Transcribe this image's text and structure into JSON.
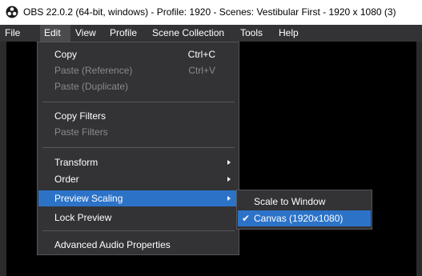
{
  "window": {
    "title": "OBS 22.0.2 (64-bit, windows) - Profile: 1920 - Scenes: Vestibular First - 1920 x 1080 (3)"
  },
  "menubar": {
    "items": [
      {
        "label": "File"
      },
      {
        "label": "Edit"
      },
      {
        "label": "View"
      },
      {
        "label": "Profile"
      },
      {
        "label": "Scene Collection"
      },
      {
        "label": "Tools"
      },
      {
        "label": "Help"
      }
    ]
  },
  "edit_menu": {
    "copy": {
      "label": "Copy",
      "shortcut": "Ctrl+C"
    },
    "paste_reference": {
      "label": "Paste (Reference)",
      "shortcut": "Ctrl+V"
    },
    "paste_duplicate": {
      "label": "Paste (Duplicate)"
    },
    "copy_filters": {
      "label": "Copy Filters"
    },
    "paste_filters": {
      "label": "Paste Filters"
    },
    "transform": {
      "label": "Transform"
    },
    "order": {
      "label": "Order"
    },
    "preview_scaling": {
      "label": "Preview Scaling"
    },
    "lock_preview": {
      "label": "Lock Preview"
    },
    "advanced_audio": {
      "label": "Advanced Audio Properties"
    }
  },
  "preview_scaling_submenu": {
    "scale_to_window": {
      "label": "Scale to Window"
    },
    "canvas": {
      "label": "Canvas (1920x1080)",
      "checked": true
    }
  },
  "colors": {
    "menu_bg": "#333336",
    "highlight": "#2c73c8",
    "disabled_text": "#8a8a8e"
  }
}
